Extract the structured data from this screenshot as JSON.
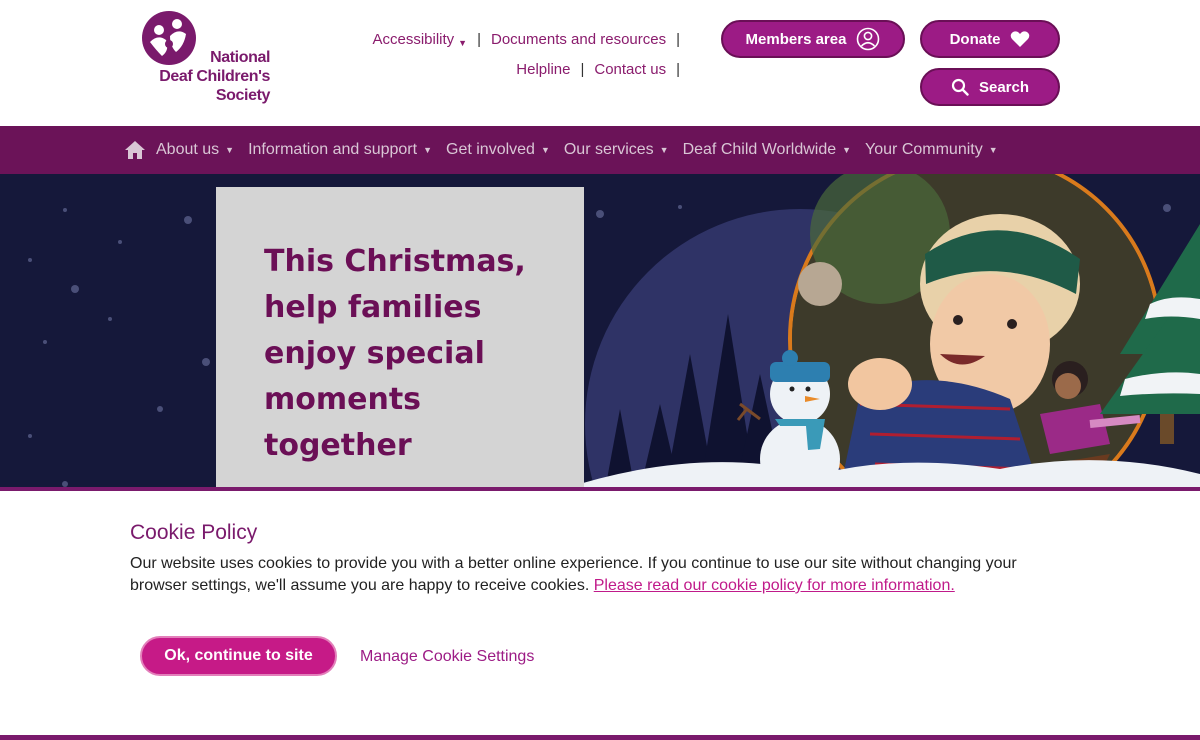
{
  "header": {
    "logo": {
      "line1": "National",
      "line2": "Deaf Children's",
      "line3": "Society"
    },
    "util_links": {
      "accessibility": "Accessibility",
      "documents": "Documents and resources",
      "helpline": "Helpline",
      "contact": "Contact us",
      "separator": "|"
    },
    "members_label": "Members area",
    "donate_label": "Donate",
    "search_label": "Search"
  },
  "nav": {
    "items": [
      {
        "label": "About us"
      },
      {
        "label": "Information and support"
      },
      {
        "label": "Get involved"
      },
      {
        "label": "Our services"
      },
      {
        "label": "Deaf Child Worldwide"
      },
      {
        "label": "Your Community"
      }
    ],
    "caret": "▼"
  },
  "hero": {
    "title": "This Christmas, help families enjoy special moments together"
  },
  "cookie": {
    "title": "Cookie Policy",
    "text": "Our website uses cookies to provide you with a better online experience. If you continue to use our site without changing your browser settings, we'll assume you are happy to receive cookies. ",
    "link": "Please read our cookie policy for more information.",
    "ok_label": "Ok, continue to site",
    "manage_label": "Manage Cookie Settings"
  },
  "colors": {
    "brand_purple": "#7a1a6c",
    "nav_bg": "#6b1358",
    "button": "#9c1b85",
    "accent_pink": "#c61a87",
    "hero_bg": "#15183a"
  }
}
